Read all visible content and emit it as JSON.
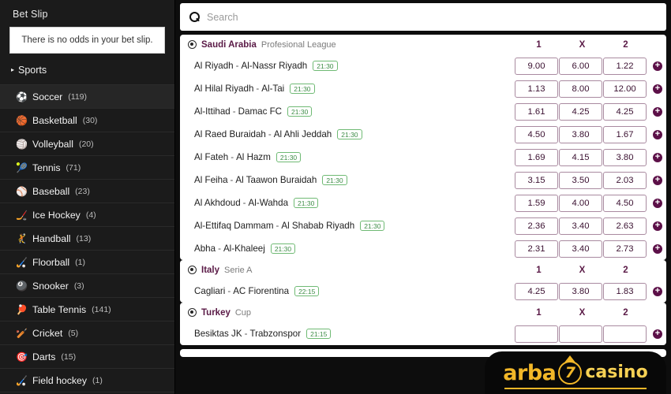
{
  "sidebar": {
    "betslip_title": "Bet Slip",
    "betslip_empty_message": "There is no odds in your bet slip.",
    "sports_header": "Sports",
    "sports": [
      {
        "icon": "soccer-ball",
        "glyph": "⚽",
        "label": "Soccer",
        "count": "(119)",
        "active": true
      },
      {
        "icon": "basketball",
        "glyph": "🏀",
        "label": "Basketball",
        "count": "(30)",
        "active": false
      },
      {
        "icon": "volleyball",
        "glyph": "🏐",
        "label": "Volleyball",
        "count": "(20)",
        "active": false
      },
      {
        "icon": "tennis-ball",
        "glyph": "🎾",
        "label": "Tennis",
        "count": "(71)",
        "active": false
      },
      {
        "icon": "baseball",
        "glyph": "⚾",
        "label": "Baseball",
        "count": "(23)",
        "active": false
      },
      {
        "icon": "ice-hockey-puck",
        "glyph": "🏒",
        "label": "Ice Hockey",
        "count": "(4)",
        "active": false
      },
      {
        "icon": "handball",
        "glyph": "🤾",
        "label": "Handball",
        "count": "(13)",
        "active": false
      },
      {
        "icon": "floorball",
        "glyph": "🏑",
        "label": "Floorball",
        "count": "(1)",
        "active": false
      },
      {
        "icon": "snooker",
        "glyph": "🎱",
        "label": "Snooker",
        "count": "(3)",
        "active": false
      },
      {
        "icon": "table-tennis-paddle",
        "glyph": "🏓",
        "label": "Table Tennis",
        "count": "(141)",
        "active": false
      },
      {
        "icon": "cricket-bat",
        "glyph": "🏏",
        "label": "Cricket",
        "count": "(5)",
        "active": false
      },
      {
        "icon": "dartboard",
        "glyph": "🎯",
        "label": "Darts",
        "count": "(15)",
        "active": false
      },
      {
        "icon": "field-hockey-stick",
        "glyph": "🏑",
        "label": "Field hockey",
        "count": "(1)",
        "active": false
      }
    ]
  },
  "search": {
    "placeholder": "Search",
    "value": "",
    "icon": "search-icon"
  },
  "odds_columns": [
    "1",
    "X",
    "2"
  ],
  "leagues": [
    {
      "country": "Saudi Arabia",
      "name": "Profesional League",
      "matches": [
        {
          "home": "Al Riyadh",
          "away": "Al-Nassr Riyadh",
          "time": "21:30",
          "odds": [
            "9.00",
            "6.00",
            "1.22"
          ]
        },
        {
          "home": "Al Hilal Riyadh",
          "away": "Al-Tai",
          "time": "21:30",
          "odds": [
            "1.13",
            "8.00",
            "12.00"
          ]
        },
        {
          "home": "Al-Ittihad",
          "away": "Damac FC",
          "time": "21:30",
          "odds": [
            "1.61",
            "4.25",
            "4.25"
          ]
        },
        {
          "home": "Al Raed Buraidah",
          "away": "Al Ahli Jeddah",
          "time": "21:30",
          "odds": [
            "4.50",
            "3.80",
            "1.67"
          ]
        },
        {
          "home": "Al Fateh",
          "away": "Al Hazm",
          "time": "21:30",
          "odds": [
            "1.69",
            "4.15",
            "3.80"
          ]
        },
        {
          "home": "Al Feiha",
          "away": "Al Taawon Buraidah",
          "time": "21:30",
          "odds": [
            "3.15",
            "3.50",
            "2.03"
          ]
        },
        {
          "home": "Al Akhdoud",
          "away": "Al-Wahda",
          "time": "21:30",
          "odds": [
            "1.59",
            "4.00",
            "4.50"
          ]
        },
        {
          "home": "Al-Ettifaq Dammam",
          "away": "Al Shabab Riyadh",
          "time": "21:30",
          "odds": [
            "2.36",
            "3.40",
            "2.63"
          ]
        },
        {
          "home": "Abha",
          "away": "Al-Khaleej",
          "time": "21:30",
          "odds": [
            "2.31",
            "3.40",
            "2.73"
          ]
        }
      ]
    },
    {
      "country": "Italy",
      "name": "Serie A",
      "matches": [
        {
          "home": "Cagliari",
          "away": "AC Fiorentina",
          "time": "22:15",
          "odds": [
            "4.25",
            "3.80",
            "1.83"
          ]
        }
      ]
    },
    {
      "country": "Turkey",
      "name": "Cup",
      "matches": [
        {
          "home": "Besiktas JK",
          "away": "Trabzonspor",
          "time": "21:15",
          "odds": [
            "",
            "",
            ""
          ]
        }
      ]
    }
  ],
  "watermark": {
    "brand_part1": "arba",
    "brand_seven": "7",
    "brand_part2": "casino"
  },
  "colors": {
    "accent_purple": "#5a1a46",
    "odds_border": "#a98aa0",
    "time_green": "#3d8c46",
    "brand_gold": "#f2b728",
    "sidebar_bg": "#1b1b1b",
    "page_bg": "#0d0d0d"
  }
}
